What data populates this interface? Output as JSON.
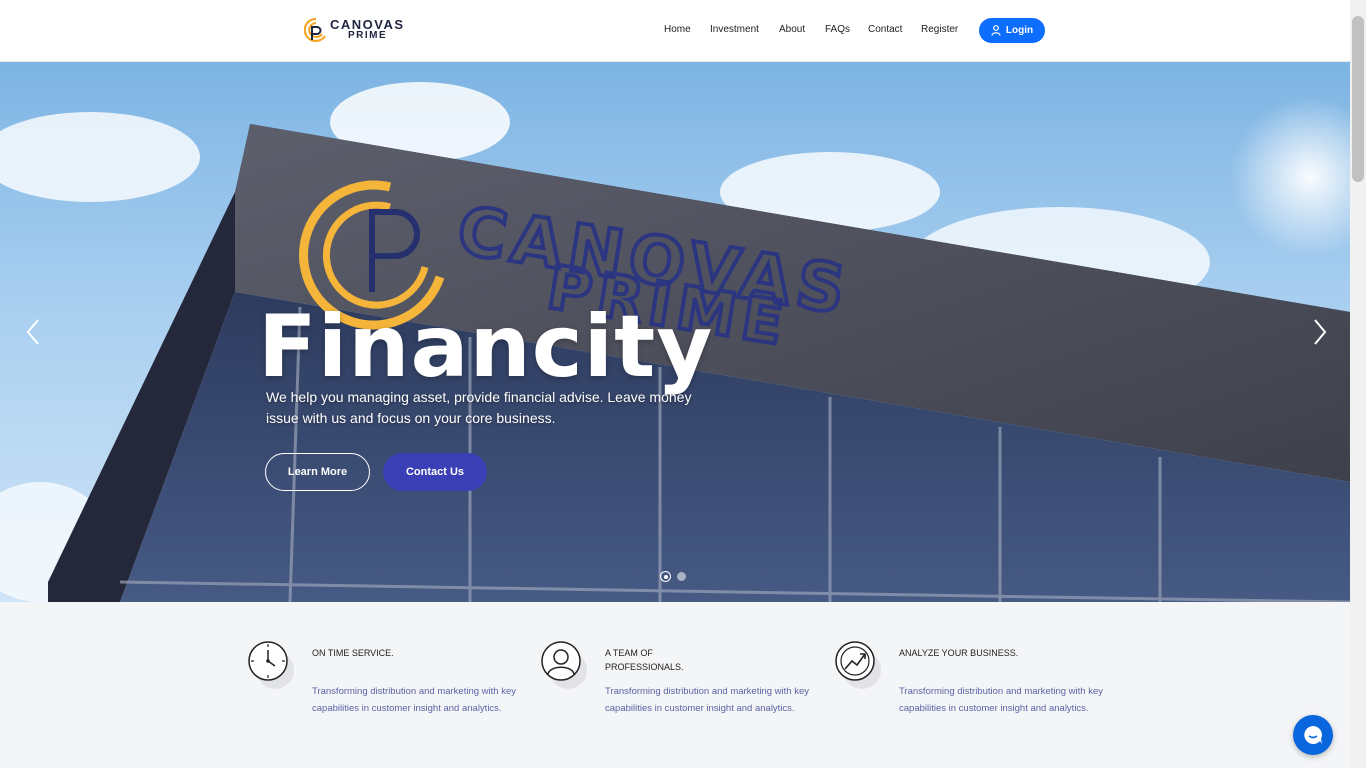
{
  "brand": {
    "line1": "CANOVAS",
    "line2": "PRIME"
  },
  "nav": {
    "home": "Home",
    "investment": "Investment",
    "about": "About",
    "faqs": "FAQs",
    "contact": "Contact",
    "register": "Register",
    "login": "Login"
  },
  "hero": {
    "title": "Financity",
    "subtitle": "We help you managing asset, provide financial advise. Leave money issue with us and focus on your core business.",
    "learn_more": "Learn More",
    "contact_us": "Contact Us",
    "sign_line1": "CANOVAS",
    "sign_line2": "PRIME",
    "slide_count": 2,
    "active_slide": 1
  },
  "features": [
    {
      "title": "ON TIME SERVICE.",
      "text": "Transforming distribution and marketing with key capabilities in customer insight and analytics.",
      "icon": "clock-icon"
    },
    {
      "title": "A TEAM OF PROFESSIONALS.",
      "text": "Transforming distribution and marketing with key capabilities in customer insight and analytics.",
      "icon": "user-icon"
    },
    {
      "title": "ANALYZE YOUR BUSINESS.",
      "text": "Transforming distribution and marketing with key capabilities in customer insight and analytics.",
      "icon": "chart-icon"
    }
  ],
  "colors": {
    "primary_blue": "#0d6efd",
    "contact_button": "#3b3fb6",
    "feature_text": "#5a63a6",
    "logo_orange": "#f5a623"
  }
}
